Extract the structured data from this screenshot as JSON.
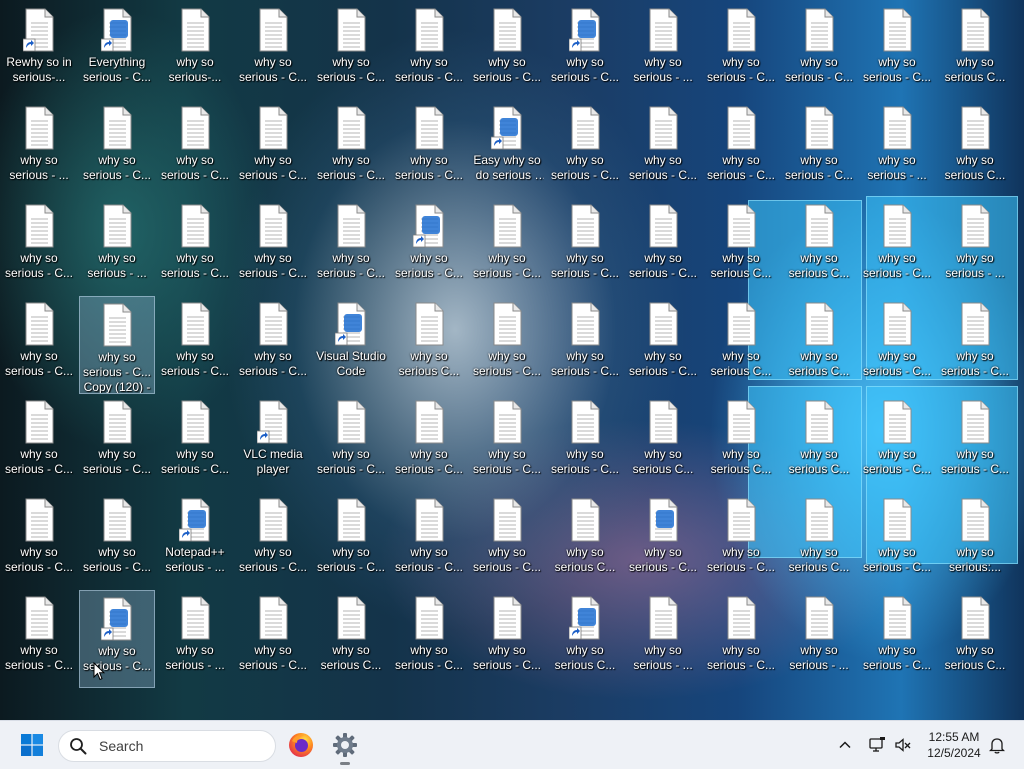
{
  "desktop": {
    "icons": [
      {
        "label": "Rewhy so in serious-...",
        "type": "file",
        "badge": "shortcut",
        "selected": false
      },
      {
        "label": "Everything serious - C...",
        "type": "app",
        "badge": "shortcut",
        "selected": false
      },
      {
        "label": "why so serious-...",
        "type": "file",
        "selected": false
      },
      {
        "label": "why so serious - C...",
        "type": "file",
        "selected": false
      },
      {
        "label": "why so serious - C...",
        "type": "file",
        "selected": false
      },
      {
        "label": "why so serious - C...",
        "type": "file",
        "selected": false
      },
      {
        "label": "why so serious - C...",
        "type": "file",
        "selected": false
      },
      {
        "label": "why so serious - C...",
        "type": "app",
        "badge": "shortcut",
        "selected": false
      },
      {
        "label": "why so serious - ...",
        "type": "file",
        "selected": false
      },
      {
        "label": "why so serious - C...",
        "type": "file",
        "selected": false
      },
      {
        "label": "why so serious - C...",
        "type": "file",
        "selected": false
      },
      {
        "label": "why so serious - C...",
        "type": "file",
        "selected": false
      },
      {
        "label": "why so serious C...",
        "type": "file",
        "selected": false
      },
      {
        "label": "why so serious - ...",
        "type": "file",
        "selected": false
      },
      {
        "label": "why so serious - C...",
        "type": "file",
        "selected": false
      },
      {
        "label": "why so serious - C...",
        "type": "file",
        "selected": false
      },
      {
        "label": "why so serious - C...",
        "type": "file",
        "selected": false
      },
      {
        "label": "why so serious - C...",
        "type": "file",
        "selected": false
      },
      {
        "label": "why so serious - C...",
        "type": "file",
        "selected": false
      },
      {
        "label": "Easy why so do serious - C...",
        "type": "app",
        "badge": "shortcut",
        "selected": false
      },
      {
        "label": "why so serious - C...",
        "type": "file",
        "selected": false
      },
      {
        "label": "why so serious - C...",
        "type": "file",
        "selected": false
      },
      {
        "label": "why so serious - C...",
        "type": "file",
        "selected": false
      },
      {
        "label": "why so serious - C...",
        "type": "file",
        "selected": false
      },
      {
        "label": "why so serious - ...",
        "type": "file",
        "selected": false
      },
      {
        "label": "why so serious C...",
        "type": "file",
        "selected": false
      },
      {
        "label": "why so serious - C...",
        "type": "file",
        "selected": false
      },
      {
        "label": "why so serious - ...",
        "type": "file",
        "selected": false
      },
      {
        "label": "why so serious - C...",
        "type": "file",
        "selected": false
      },
      {
        "label": "why so serious - C...",
        "type": "file",
        "selected": false
      },
      {
        "label": "why so serious - C...",
        "type": "file",
        "selected": false
      },
      {
        "label": "why so serious - C...",
        "type": "app",
        "badge": "shortcut",
        "selected": false
      },
      {
        "label": "why so serious - C...",
        "type": "file",
        "selected": false
      },
      {
        "label": "why so serious - C...",
        "type": "file",
        "selected": false
      },
      {
        "label": "why so serious - C...",
        "type": "file",
        "selected": false
      },
      {
        "label": "why so serious C...",
        "type": "file",
        "selected": false
      },
      {
        "label": "why so serious C...",
        "type": "file",
        "selected": false
      },
      {
        "label": "why so serious - C...",
        "type": "file",
        "selected": false
      },
      {
        "label": "why so serious - ...",
        "type": "file",
        "selected": false
      },
      {
        "label": "why so serious - C...",
        "type": "file",
        "selected": false
      },
      {
        "label": "why so serious - C... Copy (120) - Copy",
        "type": "file",
        "selected": true
      },
      {
        "label": "why so serious - C...",
        "type": "file",
        "selected": false
      },
      {
        "label": "why so serious - C...",
        "type": "file",
        "selected": false
      },
      {
        "label": "Visual Studio Code",
        "type": "app",
        "badge": "shortcut",
        "selected": false
      },
      {
        "label": "why so serious C...",
        "type": "file",
        "selected": false
      },
      {
        "label": "why so serious - C...",
        "type": "file",
        "selected": false
      },
      {
        "label": "why so serious - C...",
        "type": "file",
        "selected": false
      },
      {
        "label": "why so serious - C...",
        "type": "file",
        "selected": false
      },
      {
        "label": "why so serious C...",
        "type": "file",
        "selected": false
      },
      {
        "label": "why so serious C...",
        "type": "file",
        "selected": false
      },
      {
        "label": "why so serious - C...",
        "type": "file",
        "selected": false
      },
      {
        "label": "why so serious - C...",
        "type": "file",
        "selected": false
      },
      {
        "label": "why so serious - C...",
        "type": "file",
        "selected": false
      },
      {
        "label": "why so serious - C...",
        "type": "file",
        "selected": false
      },
      {
        "label": "why so serious - C...",
        "type": "file",
        "selected": false
      },
      {
        "label": "VLC media player",
        "type": "file",
        "badge": "shortcut",
        "selected": false
      },
      {
        "label": "why so serious - C...",
        "type": "file",
        "selected": false
      },
      {
        "label": "why so serious - C...",
        "type": "file",
        "selected": false
      },
      {
        "label": "why so serious - C...",
        "type": "file",
        "selected": false
      },
      {
        "label": "why so serious - C...",
        "type": "file",
        "selected": false
      },
      {
        "label": "why so serious C...",
        "type": "file",
        "selected": false
      },
      {
        "label": "why so serious C...",
        "type": "file",
        "selected": false
      },
      {
        "label": "why so serious C...",
        "type": "file",
        "selected": false
      },
      {
        "label": "why so serious - C...",
        "type": "file",
        "selected": false
      },
      {
        "label": "why so serious - C...",
        "type": "file",
        "selected": false
      },
      {
        "label": "why so serious - C...",
        "type": "file",
        "selected": false
      },
      {
        "label": "why so serious - C...",
        "type": "file",
        "selected": false
      },
      {
        "label": "Notepad++ serious - ...",
        "type": "app",
        "badge": "shortcut",
        "selected": false
      },
      {
        "label": "why so serious - C...",
        "type": "file",
        "selected": false
      },
      {
        "label": "why so serious - C...",
        "type": "file",
        "selected": false
      },
      {
        "label": "why so serious - C...",
        "type": "file",
        "selected": false
      },
      {
        "label": "why so serious - C...",
        "type": "file",
        "selected": false
      },
      {
        "label": "why so serious C...",
        "type": "file",
        "selected": false
      },
      {
        "label": "why so serious - C...",
        "type": "app",
        "selected": false
      },
      {
        "label": "why so serious - C...",
        "type": "file",
        "selected": false
      },
      {
        "label": "why so serious C...",
        "type": "file",
        "selected": false
      },
      {
        "label": "why so serious - C...",
        "type": "file",
        "selected": false
      },
      {
        "label": "why so serious:...",
        "type": "file",
        "selected": false
      },
      {
        "label": "why so serious - C...",
        "type": "file",
        "selected": false
      },
      {
        "label": "why so serious - C...",
        "type": "app",
        "badge": "shortcut",
        "selected": true
      },
      {
        "label": "why so serious - ...",
        "type": "file",
        "selected": false
      },
      {
        "label": "why so serious - C...",
        "type": "file",
        "selected": false
      },
      {
        "label": "why so serious C...",
        "type": "file",
        "selected": false
      },
      {
        "label": "why so serious - C...",
        "type": "file",
        "selected": false
      },
      {
        "label": "why so serious - C...",
        "type": "file",
        "selected": false
      },
      {
        "label": "why so serious C...",
        "type": "app",
        "badge": "shortcut",
        "selected": false
      },
      {
        "label": "why so serious - ...",
        "type": "file",
        "selected": false
      },
      {
        "label": "why so serious - C...",
        "type": "file",
        "selected": false
      },
      {
        "label": "why so serious - ...",
        "type": "file",
        "selected": false
      },
      {
        "label": "why so serious - C...",
        "type": "file",
        "selected": false
      },
      {
        "label": "why so serious C...",
        "type": "file",
        "selected": false
      }
    ]
  },
  "taskbar": {
    "start_icon": "windows-logo-icon",
    "search_icon": "search-icon",
    "search_label": "Search",
    "apps": [
      {
        "name": "Firefox",
        "icon": "firefox-icon"
      },
      {
        "name": "Settings",
        "icon": "gear-icon"
      }
    ],
    "tray": {
      "chevron_icon": "chevron-up-icon",
      "network_icon": "network-icon",
      "volume_icon": "volume-muted-icon",
      "notification_icon": "bell-icon"
    },
    "clock": {
      "time": "12:55 AM",
      "date": "12/5/2024"
    }
  },
  "colors": {
    "taskbar_bg": "#eef1f6",
    "accent": "#0078d4"
  }
}
